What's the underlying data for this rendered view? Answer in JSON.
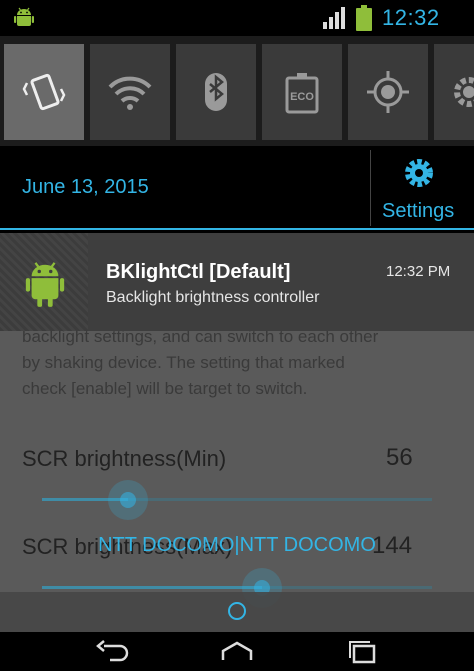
{
  "status_bar": {
    "time": "12:32",
    "icons": [
      "android-icon",
      "signal-icon",
      "battery-icon"
    ]
  },
  "quick_settings": {
    "tiles": [
      {
        "name": "vibrate",
        "icon": "vibrate-icon",
        "active": true
      },
      {
        "name": "wifi",
        "icon": "wifi-icon",
        "active": false
      },
      {
        "name": "bluetooth",
        "icon": "bluetooth-icon",
        "active": false
      },
      {
        "name": "eco",
        "icon": "eco-battery-icon",
        "active": false
      },
      {
        "name": "location",
        "icon": "gps-icon",
        "active": false
      },
      {
        "name": "more",
        "icon": "gear-icon",
        "active": false
      }
    ]
  },
  "header": {
    "date": "June 13, 2015",
    "settings_label": "Settings"
  },
  "notification": {
    "title": "BKlightCtl [Default]",
    "subtitle": "Backlight brightness controller",
    "time": "12:32 PM"
  },
  "background_app": {
    "description_lines": [
      "backlight settings, and can switch to each other",
      "by shaking device. The setting that marked",
      "check [enable] will be target to switch."
    ],
    "row1": {
      "label": "SCR brightness(Min)",
      "value": "56",
      "slider_fraction": 0.2
    },
    "row2": {
      "label": "SCR brightness(Max)",
      "value": "144",
      "slider_fraction": 0.55
    },
    "carrier": "NTT DOCOMO|NTT DOCOMO"
  },
  "colors": {
    "accent": "#33b5e5",
    "tile_active": "#6a6a6a",
    "tile_inactive": "#3a3a3a"
  }
}
